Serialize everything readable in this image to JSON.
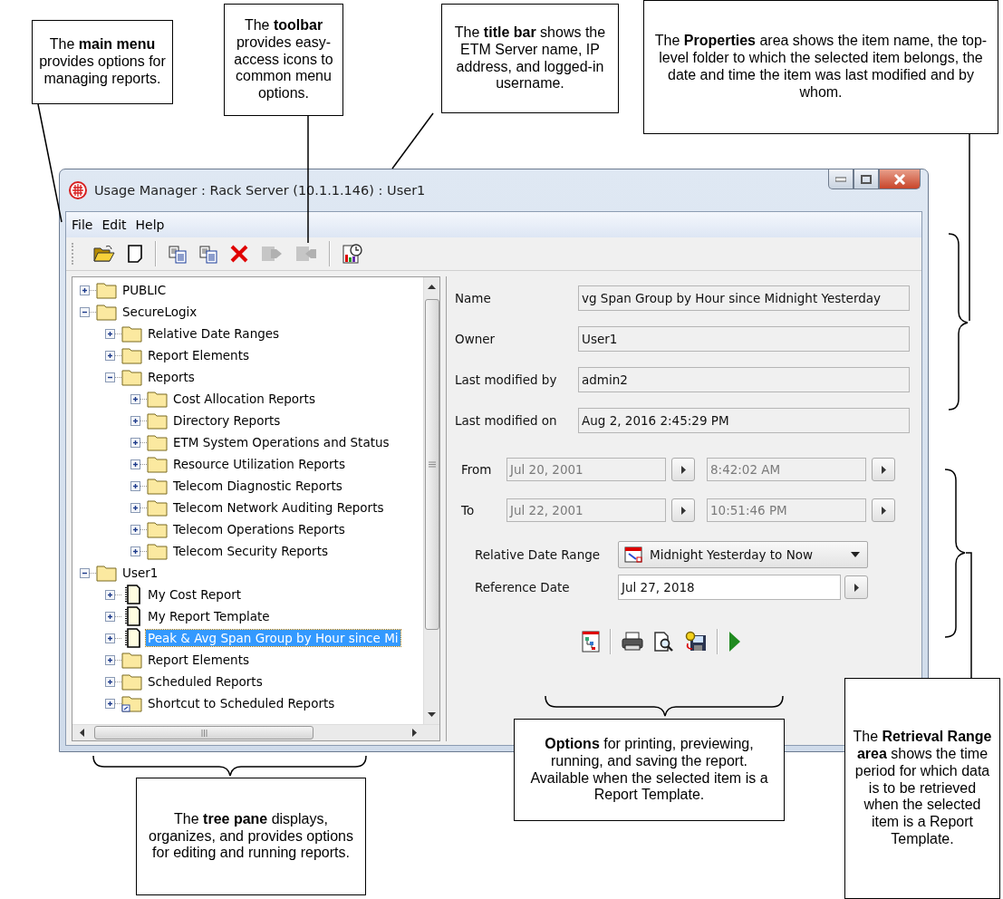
{
  "callouts": [
    {
      "text": "The **main menu** provides options for managing reports."
    },
    {
      "text": "The **toolbar** provides easy-access icons to common menu options."
    },
    {
      "text": "The **title bar** shows the ETM Server name, IP address, and logged-in username."
    },
    {
      "text": "The **Properties** area shows the item name, the top-level folder to which the selected item belongs, the date and time the item was last modified and by whom."
    },
    {
      "text": "The **tree pane** displays, organizes, and provides options for editing and running reports."
    },
    {
      "text": "**Options** for printing, previewing, running, and saving the report. Available when the selected item is a Report Template."
    },
    {
      "text": "The **Retrieval Range area** shows the time period for which data is to be retrieved when the selected item is a Report Template."
    }
  ],
  "window": {
    "title": "Usage Manager : Rack Server (10.1.1.146) : User1"
  },
  "menu": [
    "File",
    "Edit",
    "Help"
  ],
  "toolbar_groups": [
    [
      {
        "kind": "open",
        "disabled": false
      },
      {
        "kind": "new",
        "disabled": false
      }
    ],
    [
      {
        "kind": "paste",
        "disabled": false
      },
      {
        "kind": "copy",
        "disabled": false
      },
      {
        "kind": "delete",
        "disabled": false
      },
      {
        "kind": "export",
        "disabled": true
      },
      {
        "kind": "import",
        "disabled": true
      }
    ],
    [
      {
        "kind": "schedule",
        "disabled": false
      }
    ]
  ],
  "tree": [
    {
      "label": "PUBLIC",
      "kind": "folder",
      "expanded": false,
      "selected": false
    },
    {
      "label": "SecureLogix",
      "kind": "folder",
      "expanded": true,
      "selected": false,
      "children": [
        {
          "label": "Relative Date Ranges",
          "kind": "folder",
          "expanded": false,
          "selected": false
        },
        {
          "label": "Report Elements",
          "kind": "folder",
          "expanded": false,
          "selected": false
        },
        {
          "label": "Reports",
          "kind": "folder",
          "expanded": true,
          "selected": false,
          "children": [
            {
              "label": "Cost Allocation Reports",
              "kind": "folder",
              "expanded": false,
              "selected": false
            },
            {
              "label": "Directory Reports",
              "kind": "folder",
              "expanded": false,
              "selected": false
            },
            {
              "label": "ETM System Operations and Status",
              "kind": "folder",
              "expanded": false,
              "selected": false
            },
            {
              "label": "Resource Utilization Reports",
              "kind": "folder",
              "expanded": false,
              "selected": false
            },
            {
              "label": "Telecom Diagnostic Reports",
              "kind": "folder",
              "expanded": false,
              "selected": false
            },
            {
              "label": "Telecom Network Auditing Reports",
              "kind": "folder",
              "expanded": false,
              "selected": false
            },
            {
              "label": "Telecom Operations Reports",
              "kind": "folder",
              "expanded": false,
              "selected": false
            },
            {
              "label": "Telecom Security Reports",
              "kind": "folder",
              "expanded": false,
              "selected": false
            }
          ]
        }
      ]
    },
    {
      "label": "User1",
      "kind": "folder",
      "expanded": true,
      "selected": false,
      "children": [
        {
          "label": "My Cost Report",
          "kind": "report",
          "expanded": false,
          "selected": false
        },
        {
          "label": "My Report Template",
          "kind": "report",
          "expanded": false,
          "selected": false
        },
        {
          "label": "Peak & Avg Span Group by Hour since Mi",
          "kind": "report",
          "expanded": false,
          "selected": true
        },
        {
          "label": "Report Elements",
          "kind": "folder",
          "expanded": false,
          "selected": false
        },
        {
          "label": "Scheduled Reports",
          "kind": "folder",
          "expanded": false,
          "selected": false
        },
        {
          "label": "Shortcut to Scheduled Reports",
          "kind": "shortcut",
          "expanded": false,
          "selected": false
        }
      ]
    }
  ],
  "properties": [
    {
      "label": "Name",
      "value": "vg Span Group by Hour since Midnight Yesterday"
    },
    {
      "label": "Owner",
      "value": "User1"
    },
    {
      "label": "Last modified by",
      "value": "admin2"
    },
    {
      "label": "Last modified on",
      "value": "Aug 2, 2016 2:45:29 PM"
    }
  ],
  "retrieval": {
    "rows": [
      {
        "label": "From",
        "date": "Jul 20, 2001",
        "time": "8:42:02 AM",
        "disabled": true
      },
      {
        "label": "To",
        "date": "Jul 22, 2001",
        "time": "10:51:46 PM",
        "disabled": true
      }
    ],
    "relative_label": "Relative Date Range",
    "relative_value": "Midnight Yesterday to Now",
    "reference_label": "Reference Date",
    "reference_value": "Jul 27, 2018"
  },
  "option_groups": [
    [
      {
        "kind": "template"
      }
    ],
    [
      {
        "kind": "print"
      },
      {
        "kind": "preview"
      },
      {
        "kind": "save"
      }
    ],
    [
      {
        "kind": "run"
      }
    ]
  ]
}
